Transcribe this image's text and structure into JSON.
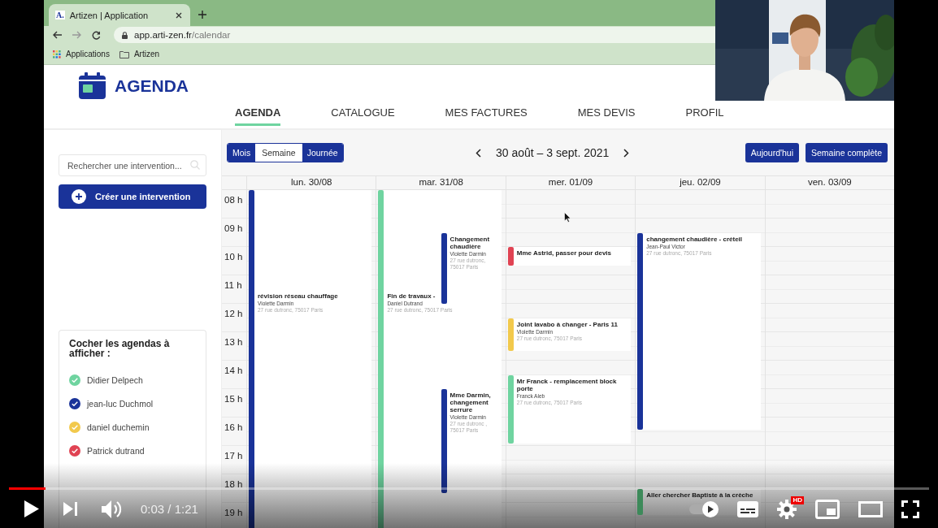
{
  "browser": {
    "tab_title": "Artizen | Application",
    "favicon": "A.",
    "url_host": "app.arti-zen.fr",
    "url_path": "/calendar",
    "bookmarks": [
      "Applications",
      "Artizen"
    ]
  },
  "app": {
    "title": "AGENDA",
    "nav": [
      {
        "label": "AGENDA",
        "selected": true
      },
      {
        "label": "CATALOGUE",
        "selected": false
      },
      {
        "label": "MES FACTURES",
        "selected": false
      },
      {
        "label": "MES DEVIS",
        "selected": false
      },
      {
        "label": "PROFIL",
        "selected": false
      }
    ]
  },
  "sidebar": {
    "search": {
      "placeholder": "Rechercher une intervention..."
    },
    "create_button": "Créer une intervention",
    "agendas_title": "Cocher les agendas à afficher :",
    "agendas": [
      {
        "name": "Didier Delpech",
        "checked": true,
        "color": "#6fd4a0"
      },
      {
        "name": "jean-luc Duchmol",
        "checked": true,
        "color": "#1a3399"
      },
      {
        "name": "daniel duchemin",
        "checked": true,
        "color": "#f2c94c"
      },
      {
        "name": "Patrick dutrand",
        "checked": true,
        "color": "#e04353"
      }
    ]
  },
  "calendar": {
    "views": [
      {
        "label": "Mois",
        "selected": false
      },
      {
        "label": "Semaine",
        "selected": true
      },
      {
        "label": "Journée",
        "selected": false
      }
    ],
    "range": "30 août – 3 sept. 2021",
    "buttons": [
      "Aujourd'hui",
      "Semaine complète"
    ],
    "hours": [
      "08 h",
      "09 h",
      "10 h",
      "11 h",
      "12 h",
      "13 h",
      "14 h",
      "15 h",
      "16 h",
      "17 h",
      "18 h",
      "19 h"
    ],
    "days": [
      {
        "label": "lun. 30/08",
        "events": [
          {
            "title": "révision réseau chauffage",
            "person": "Violette Darmin",
            "address": "27 rue dutronc, 75017 Paris",
            "color": "#1a3399"
          }
        ]
      },
      {
        "label": "mar. 31/08",
        "events": [
          {
            "title": "Fin de travaux -",
            "person": "Daniel Dutrand",
            "address": "27 rue dutronc, 75017 Paris",
            "color": "#6fd4a0"
          },
          {
            "title": "Changement chaudière",
            "person": "Violette Darmin",
            "address": "27 rue dutronc, 75017 Paris",
            "color": "#1a3399"
          },
          {
            "title": "Mme Darmin, changement serrure",
            "person": "Violette Darmin",
            "address": "27 rue dutronc , 75017 Paris",
            "color": "#1a3399"
          }
        ]
      },
      {
        "label": "mer. 01/09",
        "events": [
          {
            "title": "Mme Astrid, passer pour devis",
            "color": "#e04353"
          },
          {
            "title": "Joint lavabo à changer - Paris 11",
            "person": "Violette Darmin",
            "address": "27 rue dutronc, 75017 Paris",
            "color": "#f2c94c"
          },
          {
            "title": "Mr Franck - remplacement block porte",
            "person": "Franck Aleb",
            "address": "27 rue dutronc, 75017 Paris",
            "color": "#6fd4a0"
          }
        ]
      },
      {
        "label": "jeu. 02/09",
        "events": [
          {
            "title": "changement chaudière - créteil",
            "person": "Jean-Paul Victor",
            "address": "27 rue dutronc, 75017 Paris",
            "color": "#1a3399"
          },
          {
            "title": "Aller chercher Baptiste à la crèche",
            "color": "#3d8a5a"
          }
        ]
      },
      {
        "label": "ven. 03/09"
      }
    ]
  },
  "player": {
    "paused": true,
    "progress": {
      "level": 0.04
    },
    "time": "0:03 / 1:21",
    "autoplay": {
      "on": true
    },
    "hd_badge": "HD"
  }
}
